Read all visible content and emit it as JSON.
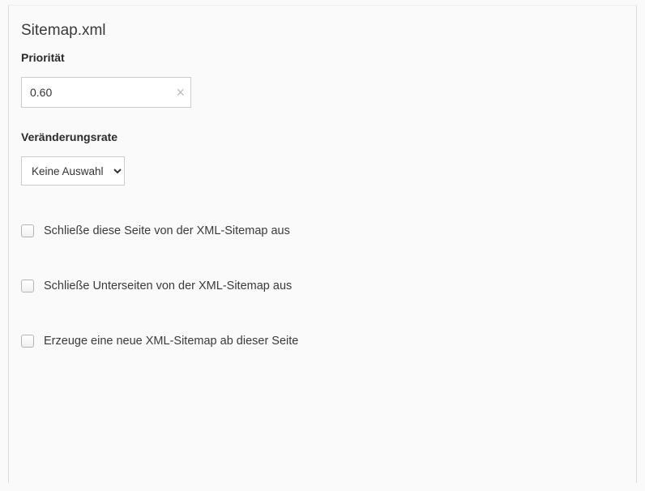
{
  "section": {
    "title": "Sitemap.xml"
  },
  "priority": {
    "label": "Priorität",
    "value": "0.60"
  },
  "changerate": {
    "label": "Veränderungsrate",
    "selected": "Keine Auswahl"
  },
  "checkboxes": {
    "exclude_page": {
      "label": "Schließe diese Seite von der XML-Sitemap aus",
      "checked": false
    },
    "exclude_subpages": {
      "label": "Schließe Unterseiten von der XML-Sitemap aus",
      "checked": false
    },
    "new_sitemap": {
      "label": "Erzeuge eine neue XML-Sitemap ab dieser Seite",
      "checked": false
    }
  }
}
